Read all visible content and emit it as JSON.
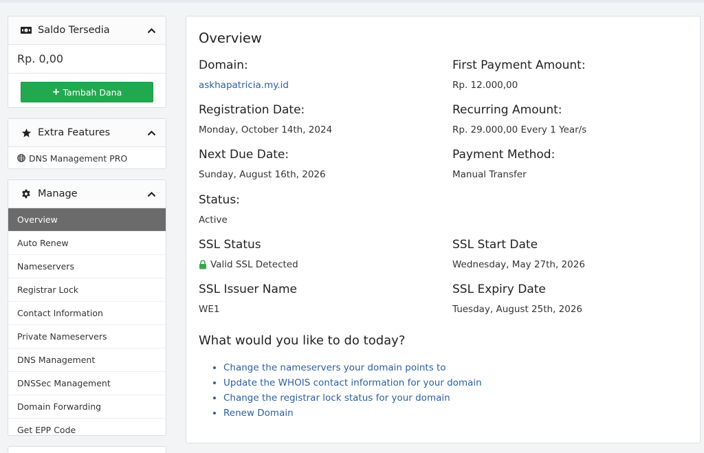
{
  "sidebar": {
    "balance_panel": {
      "title": "Saldo Tersedia",
      "icon": "money-icon",
      "amount": "Rp. 0,00",
      "button_label": "Tambah Dana"
    },
    "extra_panel": {
      "title": "Extra Features",
      "icon": "star-icon",
      "items": [
        {
          "label": "DNS Management PRO",
          "icon": "globe-icon"
        }
      ]
    },
    "manage_panel": {
      "title": "Manage",
      "icon": "gear-icon",
      "items": [
        {
          "label": "Overview",
          "active": true
        },
        {
          "label": "Auto Renew"
        },
        {
          "label": "Nameservers"
        },
        {
          "label": "Registrar Lock"
        },
        {
          "label": "Contact Information"
        },
        {
          "label": "Private Nameservers"
        },
        {
          "label": "DNS Management"
        },
        {
          "label": "DNSSec Management"
        },
        {
          "label": "Domain Forwarding"
        },
        {
          "label": "Get EPP Code"
        }
      ]
    }
  },
  "overview": {
    "title": "Overview",
    "domain_label": "Domain:",
    "domain_value": "askhapatricia.my.id",
    "first_payment_label": "First Payment Amount:",
    "first_payment_value": "Rp. 12.000,00",
    "registration_label": "Registration Date:",
    "registration_value": "Monday, October 14th, 2024",
    "recurring_label": "Recurring Amount:",
    "recurring_value": "Rp. 29.000,00 Every 1 Year/s",
    "next_due_label": "Next Due Date:",
    "next_due_value": "Sunday, August 16th, 2026",
    "payment_method_label": "Payment Method:",
    "payment_method_value": "Manual Transfer",
    "status_label": "Status:",
    "status_value": "Active",
    "ssl_status_label": "SSL Status",
    "ssl_status_value": "Valid SSL Detected",
    "ssl_start_label": "SSL Start Date",
    "ssl_start_value": "Wednesday, May 27th, 2026",
    "ssl_issuer_label": "SSL Issuer Name",
    "ssl_issuer_value": "WE1",
    "ssl_expiry_label": "SSL Expiry Date",
    "ssl_expiry_value": "Tuesday, August 25th, 2026",
    "actions_title": "What would you like to do today?",
    "actions": [
      "Change the nameservers your domain points to",
      "Update the WHOIS contact information for your domain",
      "Change the registrar lock status for your domain",
      "Renew Domain"
    ]
  },
  "colors": {
    "accent_link": "#2c5f9e",
    "button_green": "#22a94f",
    "active_menu": "#6b6b6b",
    "ssl_lock": "#3aa54a"
  }
}
